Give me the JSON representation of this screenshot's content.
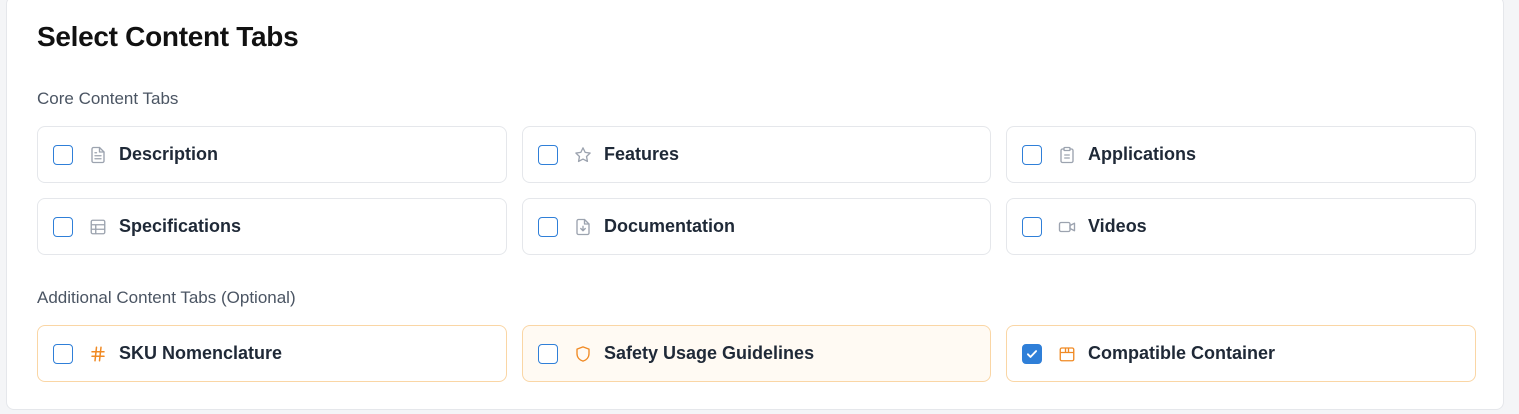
{
  "title": "Select Content Tabs",
  "core_section": {
    "label": "Core Content Tabs",
    "items": [
      {
        "label": "Description",
        "icon": "document-icon",
        "checked": false
      },
      {
        "label": "Features",
        "icon": "star-icon",
        "checked": false
      },
      {
        "label": "Applications",
        "icon": "clipboard-icon",
        "checked": false
      },
      {
        "label": "Specifications",
        "icon": "table-icon",
        "checked": false
      },
      {
        "label": "Documentation",
        "icon": "file-download-icon",
        "checked": false
      },
      {
        "label": "Videos",
        "icon": "video-icon",
        "checked": false
      }
    ]
  },
  "additional_section": {
    "label": "Additional Content Tabs (Optional)",
    "items": [
      {
        "label": "SKU Nomenclature",
        "icon": "hash-icon",
        "checked": false
      },
      {
        "label": "Safety Usage Guidelines",
        "icon": "shield-icon",
        "checked": false
      },
      {
        "label": "Compatible Container",
        "icon": "package-icon",
        "checked": true
      }
    ]
  },
  "colors": {
    "accent": "#2f7fd8",
    "optional_icon": "#f08a24",
    "core_icon": "#9ca3af"
  }
}
